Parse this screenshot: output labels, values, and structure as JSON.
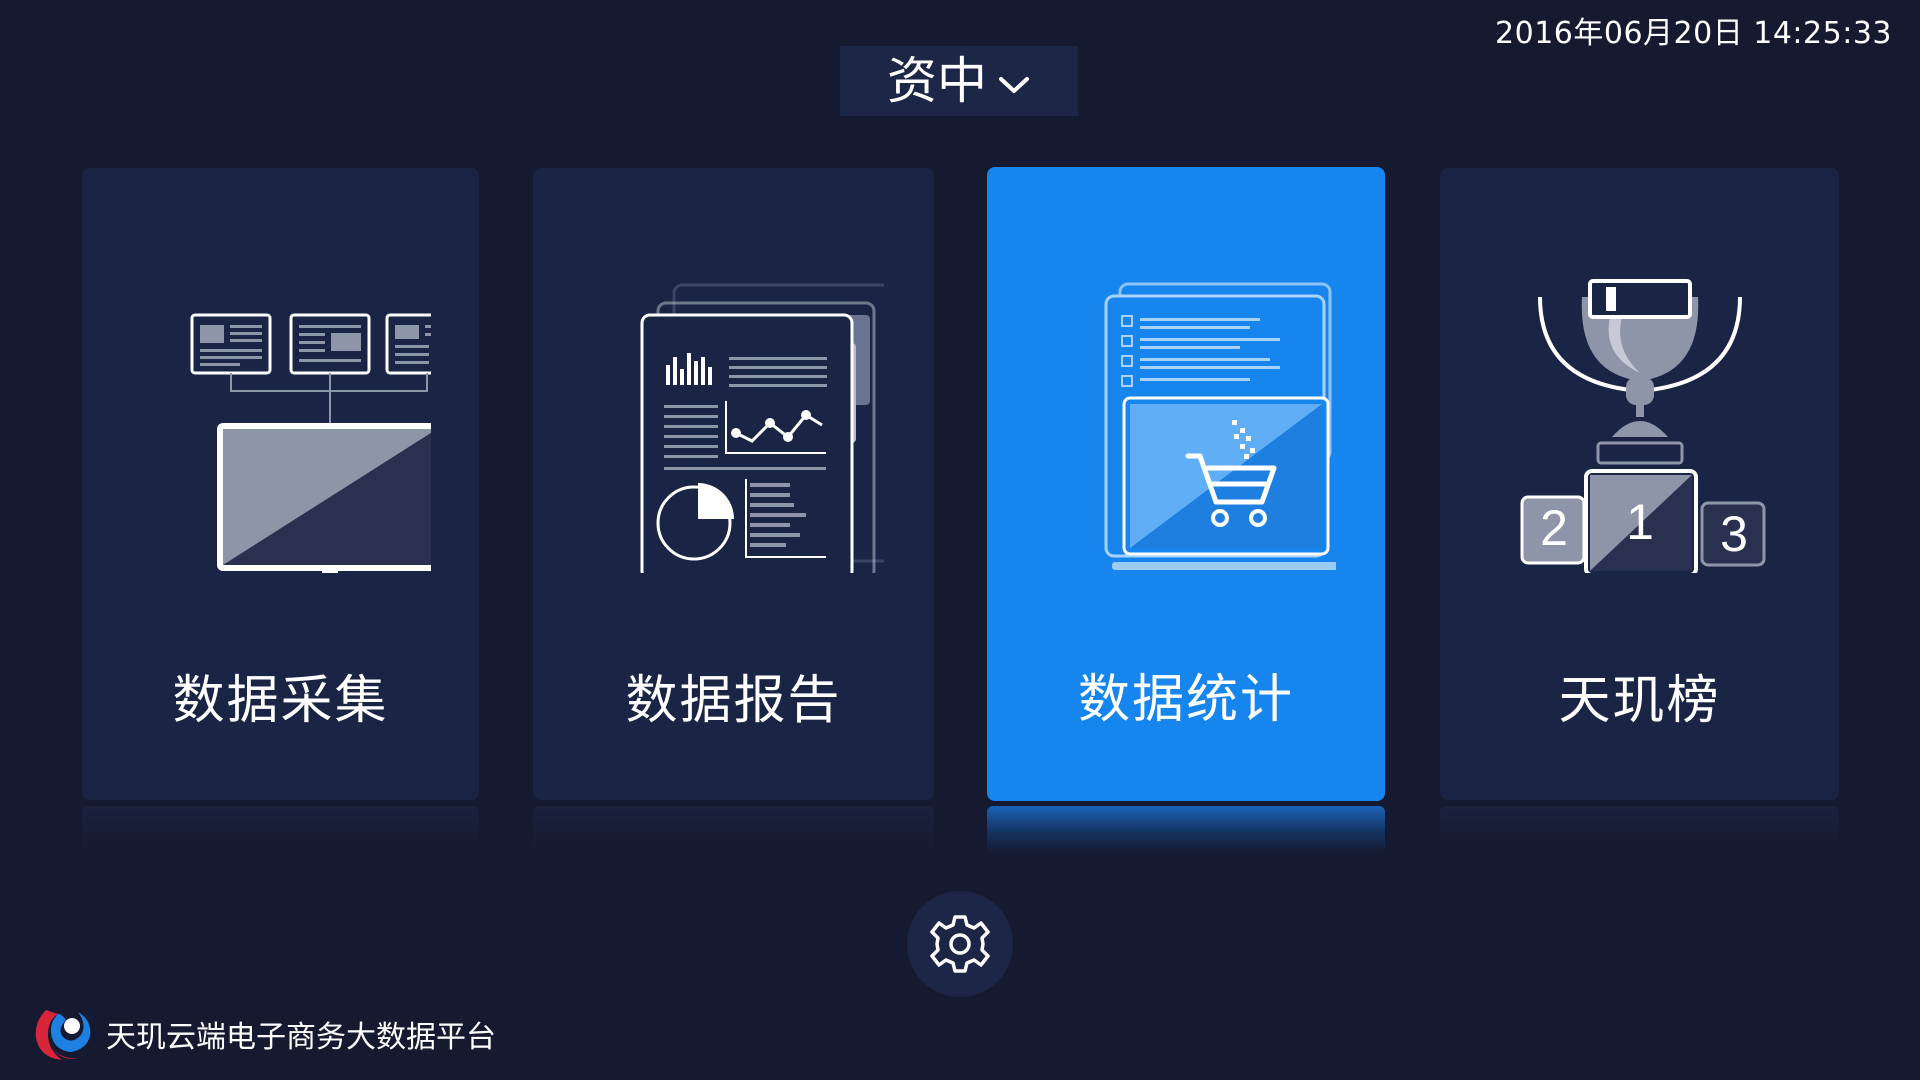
{
  "header": {
    "datetime": "2016年06月20日 14:25:33",
    "region_selector": {
      "label": "资中",
      "icon": "chevron-down-icon"
    }
  },
  "cards": [
    {
      "id": "collect",
      "label": "数据采集",
      "icon": "data-collection-icon",
      "active": false
    },
    {
      "id": "report",
      "label": "数据报告",
      "icon": "data-report-icon",
      "active": false
    },
    {
      "id": "stats",
      "label": "数据统计",
      "icon": "data-statistics-icon",
      "active": true
    },
    {
      "id": "rank",
      "label": "天玑榜",
      "icon": "ranking-trophy-icon",
      "active": false
    }
  ],
  "ranking_podium": {
    "first": "1",
    "second": "2",
    "third": "3"
  },
  "settings": {
    "icon": "gear-icon"
  },
  "footer": {
    "brand_name": "天玑云端电子商务大数据平台",
    "logo": "brand-logo-icon"
  },
  "colors": {
    "background": "#161a30",
    "card": "#1a2444",
    "card_active": "#1785ee",
    "selector_bg": "#1c2647",
    "text": "#ffffff"
  }
}
